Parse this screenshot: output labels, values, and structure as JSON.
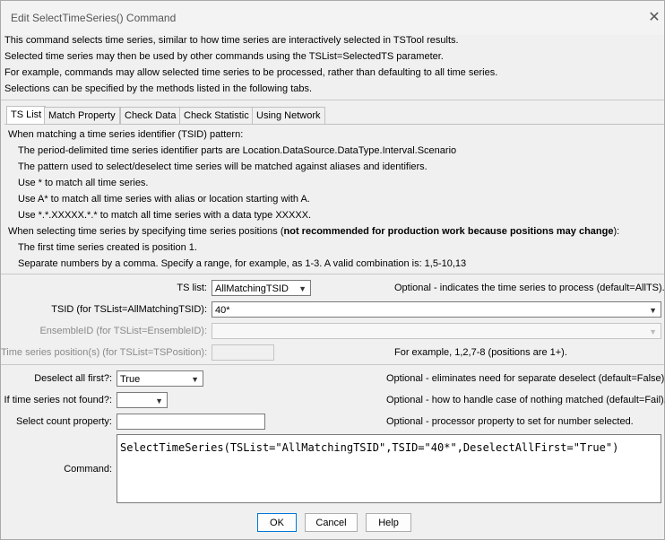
{
  "window": {
    "title": "Edit SelectTimeSeries() Command"
  },
  "description": [
    "This command selects time series, similar to how time series are interactively selected in TSTool results.",
    "Selected time series may then be used by other commands using the TSList=SelectedTS parameter.",
    "For example, commands may allow selected time series to be processed, rather than defaulting to all time series.",
    "Selections can be specified by the methods listed in the following tabs."
  ],
  "tabs": [
    {
      "label": "TS List"
    },
    {
      "label": "Match Property"
    },
    {
      "label": "Check Data"
    },
    {
      "label": "Check Statistic"
    },
    {
      "label": "Using Network"
    }
  ],
  "tab_panel": {
    "lines": [
      "When matching a time series identifier (TSID) pattern:",
      "The period-delimited time series identifier parts are Location.DataSource.DataType.Interval.Scenario",
      "The pattern used to select/deselect time series will be matched against aliases and identifiers.",
      "Use * to match all time series.",
      "Use A* to match all time series with alias or location starting with A.",
      "Use *.*.XXXXX.*.* to match all time series with a data type XXXXX.",
      "The first time series created is position 1.",
      "Separate numbers by a comma.  Specify a range, for example, as 1-3.  A valid combination is: 1,5-10,13"
    ],
    "position_line_normal": "When selecting time series by specifying time series positions (",
    "position_line_bold": "not recommended for production work because positions may change",
    "position_line_end": "):"
  },
  "form": {
    "ts_list": {
      "label": "TS list:",
      "value": "AllMatchingTSID",
      "note": "Optional - indicates the time series to process (default=AllTS)."
    },
    "tsid": {
      "label": "TSID (for TSList=AllMatchingTSID):",
      "value": "40*"
    },
    "ensemble_id": {
      "label": "EnsembleID (for TSList=EnsembleID):",
      "value": ""
    },
    "ts_position": {
      "label": "Time series position(s) (for TSList=TSPosition):",
      "value": "",
      "note": "For example, 1,2,7-8 (positions are 1+)."
    },
    "deselect_all_first": {
      "label": "Deselect all first?:",
      "value": "True",
      "note": "Optional - eliminates need for separate deselect (default=False)."
    },
    "if_not_found": {
      "label": "If time series not found?:",
      "value": "",
      "note": "Optional - how to handle case of nothing matched (default=Fail)."
    },
    "select_count_property": {
      "label": "Select count property:",
      "value": "",
      "note": "Optional - processor property to set for number selected."
    },
    "command": {
      "label": "Command:",
      "value": "SelectTimeSeries(TSList=\"AllMatchingTSID\",TSID=\"40*\",DeselectAllFirst=\"True\")"
    }
  },
  "buttons": {
    "ok": "OK",
    "cancel": "Cancel",
    "help": "Help"
  },
  "icons": {
    "close": "close-icon",
    "dropdown": "chevron-down-icon"
  }
}
